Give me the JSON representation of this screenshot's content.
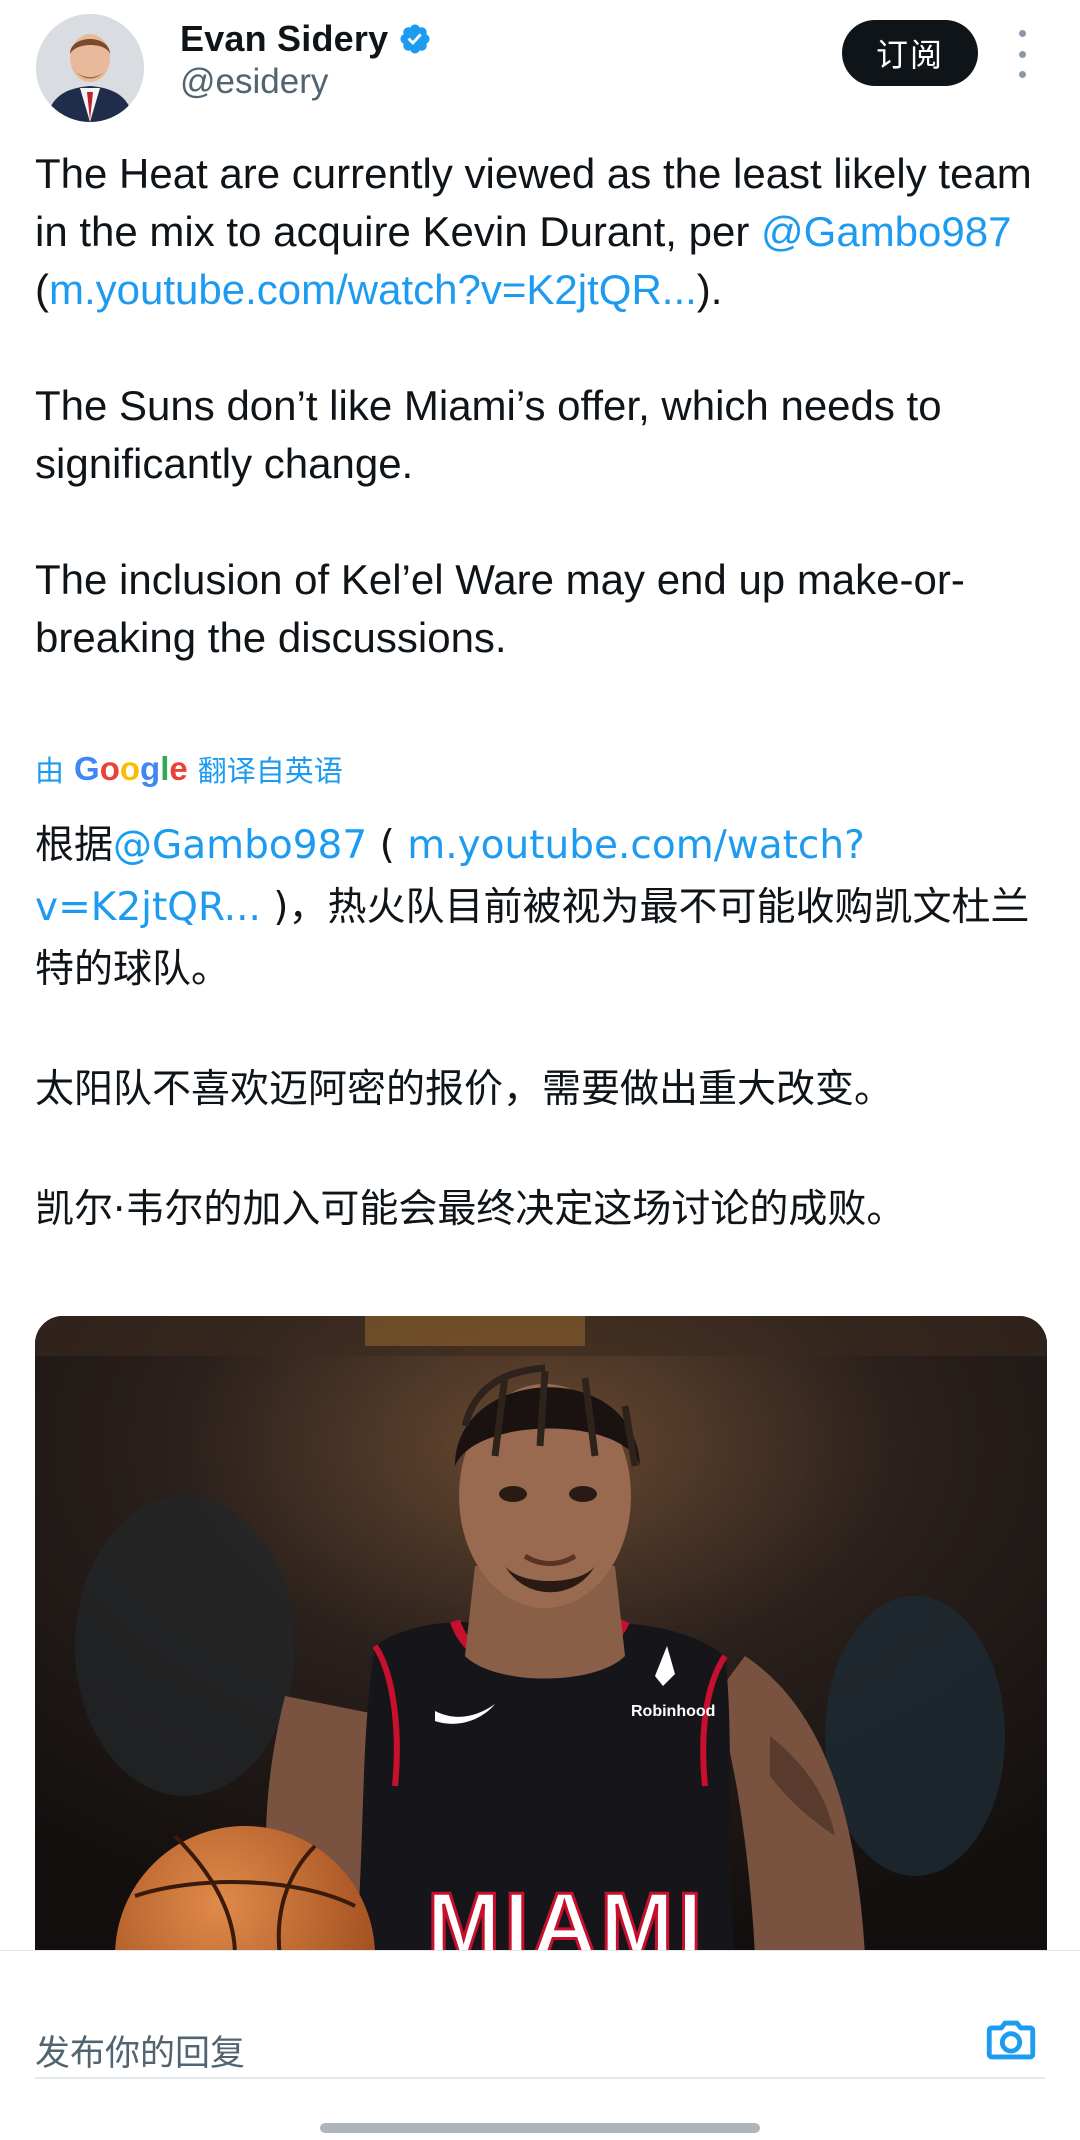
{
  "author": {
    "display_name": "Evan Sidery",
    "handle": "@esidery",
    "verified": true
  },
  "header": {
    "subscribe_label": "订阅",
    "more_icon": "more-vertical-icon"
  },
  "tweet": {
    "p1_a": "The Heat are currently viewed as the least likely team in the mix to acquire Kevin Durant, per ",
    "p1_mention": "@Gambo987",
    "p1_open": " (",
    "p1_link": "m.youtube.com/watch?v=K2jtQR...",
    "p1_close": ").",
    "p2": "The Suns don’t like Miami’s offer, which needs to significantly change.",
    "p3": "The inclusion of Kel’el Ware may end up make-or-breaking the discussions."
  },
  "translation": {
    "prefix": "由",
    "brand": "Google",
    "suffix": "翻译自英语",
    "p1_a": "根据",
    "p1_mention": "@Gambo987",
    "p1_open": " ( ",
    "p1_link": "m.youtube.com/watch?v=K2jtQR...",
    "p1_b": " )，热火队目前被视为最不可能收购凯文杜兰特的球队。",
    "p2": "太阳队不喜欢迈阿密的报价，需要做出重大改变。",
    "p3": "凯尔·韦尔的加入可能会最终决定这场讨论的成败。"
  },
  "media": {
    "jersey_text": "MIAMI",
    "sponsor_text": "Robinhood"
  },
  "reply": {
    "placeholder": "发布你的回复",
    "camera_icon": "camera-icon"
  },
  "colors": {
    "link": "#1d9bf0",
    "subscribe_bg": "#0f1419",
    "secondary_text": "#536471"
  }
}
